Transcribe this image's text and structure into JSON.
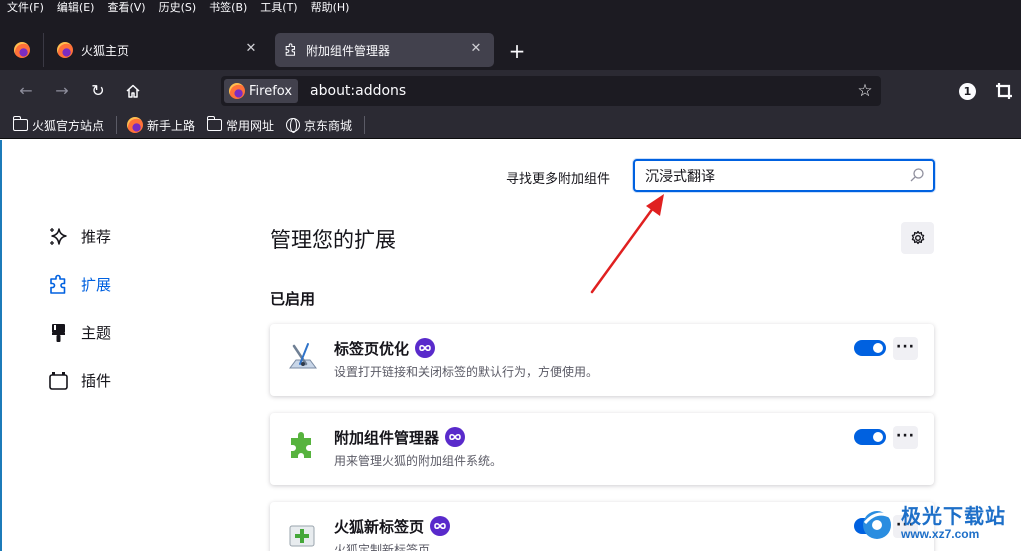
{
  "menubar": {
    "items": [
      "文件(F)",
      "编辑(E)",
      "查看(V)",
      "历史(S)",
      "书签(B)",
      "工具(T)",
      "帮助(H)"
    ]
  },
  "tabs": {
    "home_title": "火狐主页",
    "active_title": "附加组件管理器",
    "close_glyph": "✕",
    "new_tab_glyph": "+"
  },
  "navbar": {
    "back_glyph": "←",
    "forward_glyph": "→",
    "reload_glyph": "↻",
    "identity_label": "Firefox",
    "url": "about:addons",
    "star_glyph": "☆",
    "badge_count": "1"
  },
  "bookmarks": {
    "items": [
      {
        "label": "火狐官方站点",
        "icon": "folder-icon"
      },
      {
        "label": "新手上路",
        "icon": "firefox-icon"
      },
      {
        "label": "常用网址",
        "icon": "folder-icon"
      },
      {
        "label": "京东商城",
        "icon": "globe-icon"
      }
    ]
  },
  "content": {
    "search_label": "寻找更多附加组件",
    "search_value": "沉浸式翻译",
    "sidebar": [
      {
        "label": "推荐",
        "icon": "sparkle-icon",
        "active": false
      },
      {
        "label": "扩展",
        "icon": "puzzle-icon",
        "active": true
      },
      {
        "label": "主题",
        "icon": "brush-icon",
        "active": false
      },
      {
        "label": "插件",
        "icon": "plugin-icon",
        "active": false
      }
    ],
    "page_title": "管理您的扩展",
    "section_title": "已启用",
    "more_glyph": "···",
    "addons": [
      {
        "name": "标签页优化",
        "description": "设置打开链接和关闭标签的默认行为，方便使用。",
        "enabled": true,
        "icon": "tab-tweak-icon"
      },
      {
        "name": "附加组件管理器",
        "description": "用来管理火狐的附加组件系统。",
        "enabled": true,
        "icon": "green-puzzle-icon"
      },
      {
        "name": "火狐新标签页",
        "description": "火狐定制新标签页",
        "enabled": true,
        "icon": "new-tab-icon"
      }
    ]
  },
  "watermark": {
    "title": "极光下载站",
    "url": "www.xz7.com"
  },
  "colors": {
    "accent": "#0061e0",
    "recommended_badge": "#592acb",
    "arrow": "#e02020",
    "toolbar": "#2b2a33",
    "tabbar": "#1c1b22"
  }
}
